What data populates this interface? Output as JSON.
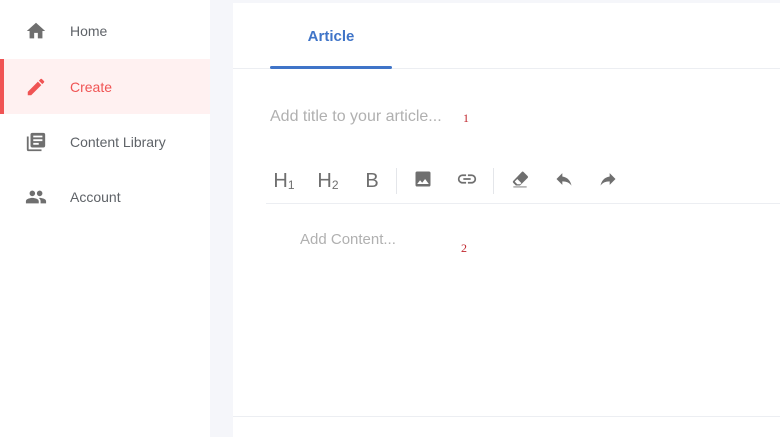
{
  "sidebar": {
    "items": [
      {
        "label": "Home",
        "icon": "home-icon",
        "active": false
      },
      {
        "label": "Create",
        "icon": "pencil-icon",
        "active": true
      },
      {
        "label": "Content Library",
        "icon": "library-icon",
        "active": false
      },
      {
        "label": "Account",
        "icon": "people-icon",
        "active": false
      }
    ]
  },
  "main": {
    "tab_label": "Article",
    "title_placeholder": "Add title to your article...",
    "title_marker": "1",
    "content_placeholder": "Add Content...",
    "content_marker": "2"
  },
  "toolbar": {
    "h1_label": "H",
    "h1_sub": "1",
    "h2_label": "H",
    "h2_sub": "2",
    "bold_label": "B",
    "tools": [
      "heading-1",
      "heading-2",
      "bold",
      "image-icon",
      "link-icon",
      "eraser-icon",
      "undo-icon",
      "redo-icon"
    ]
  },
  "colors": {
    "accent": "#3f74c8",
    "active": "#f05454",
    "active_bg": "#fff1f1",
    "marker": "#c0262d"
  }
}
